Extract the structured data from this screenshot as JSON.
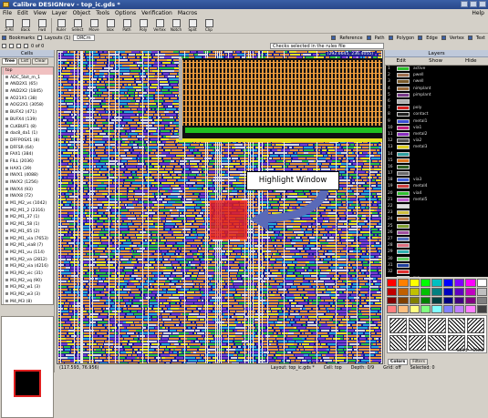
{
  "title": "Calibre DESIGNrev - top_ic.gds *",
  "menu": [
    "File",
    "Edit",
    "View",
    "Layer",
    "Object",
    "Tools",
    "Options",
    "Verification",
    "Macros"
  ],
  "menu_help": "Help",
  "toolbar1": [
    "Z-All",
    "Back",
    "Fwd",
    "Ruler",
    "Select",
    "Move",
    "Box",
    "Path",
    "Poly",
    "Vertex",
    "Notch",
    "Split",
    "Clip"
  ],
  "toolbar2": {
    "bookmarks": "Bookmarks",
    "layouts": "Layouts (1)",
    "drc": "DRCm",
    "right": [
      "Reference",
      "Path",
      "Polygon",
      "Edge",
      "Vertex",
      "Text"
    ]
  },
  "toolbar3": {
    "page": "0 of 0",
    "message": "Checks selected in the rules file"
  },
  "cells": {
    "title": "Cells",
    "tabs": [
      "Tree",
      "List",
      "Clear"
    ],
    "items": [
      "top",
      "ADC_5bit_m_1",
      "AND2X1 (65)",
      "AND2X2 (1845)",
      "AO21X1 (38)",
      "AOI22X1 (3058)",
      "BUFX2 (471)",
      "BUFX4 (139)",
      "CLKBUF1 (8)",
      "dac8_da1 (1)",
      "DFFPOSX1 (8)",
      "DFFSR (64)",
      "FAX1 (384)",
      "FILL (2036)",
      "HAX1 (39)",
      "INVX1 (4088)",
      "INVX2 (1256)",
      "INVX4 (93)",
      "INVX8 (72)",
      "M1_M2_vs (1042)",
      "M2_M1_2 (2316)",
      "M2_M1_37 (1)",
      "M2_M1_58 (1)",
      "M2_M1_65 (2)",
      "M2_M1_via (7653)",
      "M2_M1_via8 (7)",
      "M2_M1_vu (114)",
      "M3_M2_va (2812)",
      "M3_M2_via (4216)",
      "M3_M2_vic (31)",
      "M3_M2_vq (90)",
      "M3_M2_w1 (3)",
      "M3_M2_w3 (3)",
      "M4_M3 (8)"
    ]
  },
  "canvas": {
    "coord_top": "(292.6645, 236.4055)",
    "callout": "Highlight Window"
  },
  "status": {
    "coord": "(117.593, 76.956)",
    "layout": "Layout: top_ic.gds *",
    "cell": "Cell: top",
    "depth": "Depth: 0/9",
    "grid": "Grid: off",
    "selected": "Selected: 0"
  },
  "layers": {
    "title": "Layers",
    "header": [
      "Edit",
      "Show",
      "Hide"
    ],
    "rows": [
      {
        "num": "1",
        "name": "active",
        "color": "#2bbf2b"
      },
      {
        "num": "2",
        "name": "pwell",
        "color": "#a07050"
      },
      {
        "num": "3",
        "name": "nwell",
        "color": "#7a5a2a"
      },
      {
        "num": "4",
        "name": "nimplant",
        "color": "#9a6a3a"
      },
      {
        "num": "5",
        "name": "pimplant",
        "color": "#7a3a8a"
      },
      {
        "num": "6",
        "name": "",
        "color": "#b0b0b0"
      },
      {
        "num": "7",
        "name": "poly",
        "color": "#d62020"
      },
      {
        "num": "8",
        "name": "contact",
        "color": "#202020"
      },
      {
        "num": "9",
        "name": "metal1",
        "color": "#3a4fd6"
      },
      {
        "num": "10",
        "name": "via1",
        "color": "#c02080"
      },
      {
        "num": "11",
        "name": "metal2",
        "color": "#8a30c0"
      },
      {
        "num": "12",
        "name": "via2",
        "color": "#505050"
      },
      {
        "num": "13",
        "name": "metal3",
        "color": "#e0d020"
      },
      {
        "num": "14",
        "name": "",
        "color": "#30a0a0"
      },
      {
        "num": "15",
        "name": "",
        "color": "#e07820"
      },
      {
        "num": "16",
        "name": "",
        "color": "#306020"
      },
      {
        "num": "17",
        "name": "",
        "color": "#6a6a6a"
      },
      {
        "num": "18",
        "name": "via3",
        "color": "#4060e0"
      },
      {
        "num": "19",
        "name": "metal4",
        "color": "#d04040"
      },
      {
        "num": "20",
        "name": "via4",
        "color": "#30c030"
      },
      {
        "num": "21",
        "name": "metal5",
        "color": "#c060d0"
      },
      {
        "num": "22",
        "name": "",
        "color": "#e0e0e0"
      },
      {
        "num": "23",
        "name": "",
        "color": "#d0c040"
      },
      {
        "num": "24",
        "name": "",
        "color": "#c08050"
      },
      {
        "num": "25",
        "name": "",
        "color": "#80a030"
      },
      {
        "num": "26",
        "name": "",
        "color": "#a050a0"
      },
      {
        "num": "27",
        "name": "",
        "color": "#5070c0"
      },
      {
        "num": "28",
        "name": "",
        "color": "#e07080"
      },
      {
        "num": "29",
        "name": "",
        "color": "#30b0b0"
      },
      {
        "num": "30",
        "name": "",
        "color": "#60d060"
      },
      {
        "num": "31",
        "name": "",
        "color": "#2040a0"
      },
      {
        "num": "32",
        "name": "",
        "color": "#e03030"
      },
      {
        "num": "",
        "name": "rve",
        "color": "#d0d020"
      }
    ]
  },
  "palette_colors": [
    "#ff0000",
    "#ff8000",
    "#ffff00",
    "#00ff00",
    "#00c0c0",
    "#0000ff",
    "#8000ff",
    "#ff00ff",
    "#ffffff",
    "#c00000",
    "#c06000",
    "#c0c000",
    "#00c000",
    "#008080",
    "#0000c0",
    "#6000c0",
    "#c000c0",
    "#c0c0c0",
    "#800000",
    "#804000",
    "#808000",
    "#008000",
    "#004040",
    "#000080",
    "#400080",
    "#800080",
    "#808080",
    "#ff8080",
    "#ffc080",
    "#ffff80",
    "#80ff80",
    "#80ffff",
    "#8080ff",
    "#c080ff",
    "#ff80ff",
    "#404040"
  ],
  "palette_buttons": {
    "solid": "Solid",
    "clear": "Clear",
    "tabs": [
      "Colors",
      "Filters"
    ]
  }
}
